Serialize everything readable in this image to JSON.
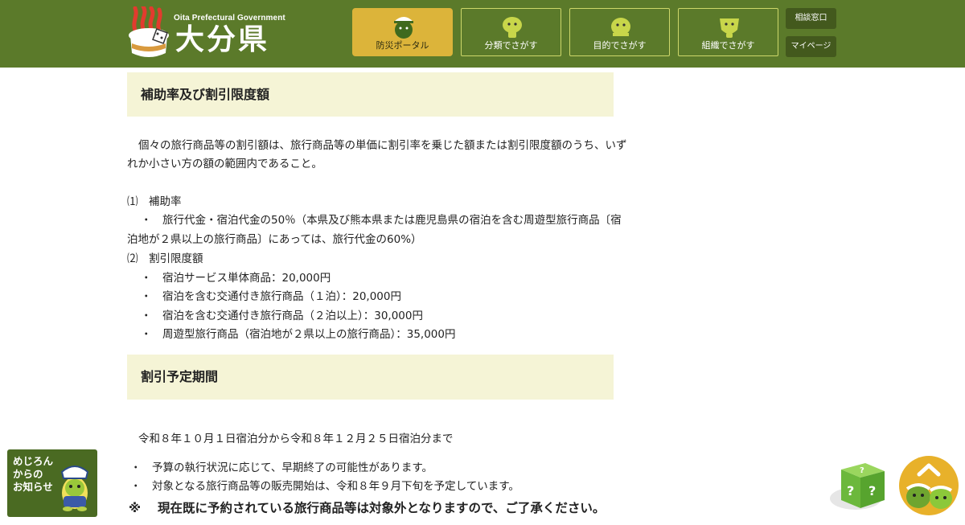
{
  "header": {
    "logo_en": "Oita Prefectural Government",
    "logo_jp": "大分県",
    "nav": [
      {
        "label": "防災ポータル",
        "active": true
      },
      {
        "label": "分類でさがす",
        "active": false
      },
      {
        "label": "目的でさがす",
        "active": false
      },
      {
        "label": "組織でさがす",
        "active": false
      }
    ],
    "side_links": [
      "相談窓口",
      "マイページ"
    ]
  },
  "content": {
    "section1_title": "補助率及び割引限度額",
    "intro_line1": "個々の旅行商品等の割引額は、旅行商品等の単価に割引率を乗じた額または割引限度額のうち、いず",
    "intro_line2": "れか小さい方の額の範囲内であること。",
    "sub1_label": "⑴　補助率",
    "sub1_item_line1": "・　旅行代金・宿泊代金の50％（本県及び熊本県または鹿児島県の宿泊を含む周遊型旅行商品〔宿",
    "sub1_item_line2": "泊地が２県以上の旅行商品〕にあっては、旅行代金の60%）",
    "sub2_label": "⑵　割引限度額",
    "sub2_items": [
      "・　宿泊サービス単体商品：20,000円",
      "・　宿泊を含む交通付き旅行商品（１泊）：20,000円",
      "・　宿泊を含む交通付き旅行商品（２泊以上）：30,000円",
      "・　周遊型旅行商品（宿泊地が２県以上の旅行商品）：35,000円"
    ],
    "section2_title": "割引予定期間",
    "period": "令和８年１０月１日宿泊分から令和８年１２月２５日宿泊分まで",
    "notes": [
      "・　予算の執行状況に応じて、早期終了の可能性があります。",
      "・　対象となる旅行商品等の販売開始は、令和８年９月下旬を予定しています。"
    ],
    "warning": "※　 現在既に予約されている旅行商品等は対象外となりますので、ご了承ください。"
  },
  "floating": {
    "notice_lines": [
      "めじろん",
      "からの",
      "お知らせ"
    ]
  },
  "colors": {
    "header_bg": "#5b7a2a",
    "nav_active_bg": "#dcb43a",
    "nav_border": "#cdd76a",
    "section_bg": "#f5f4d6",
    "side_btn_bg": "#43591d"
  }
}
